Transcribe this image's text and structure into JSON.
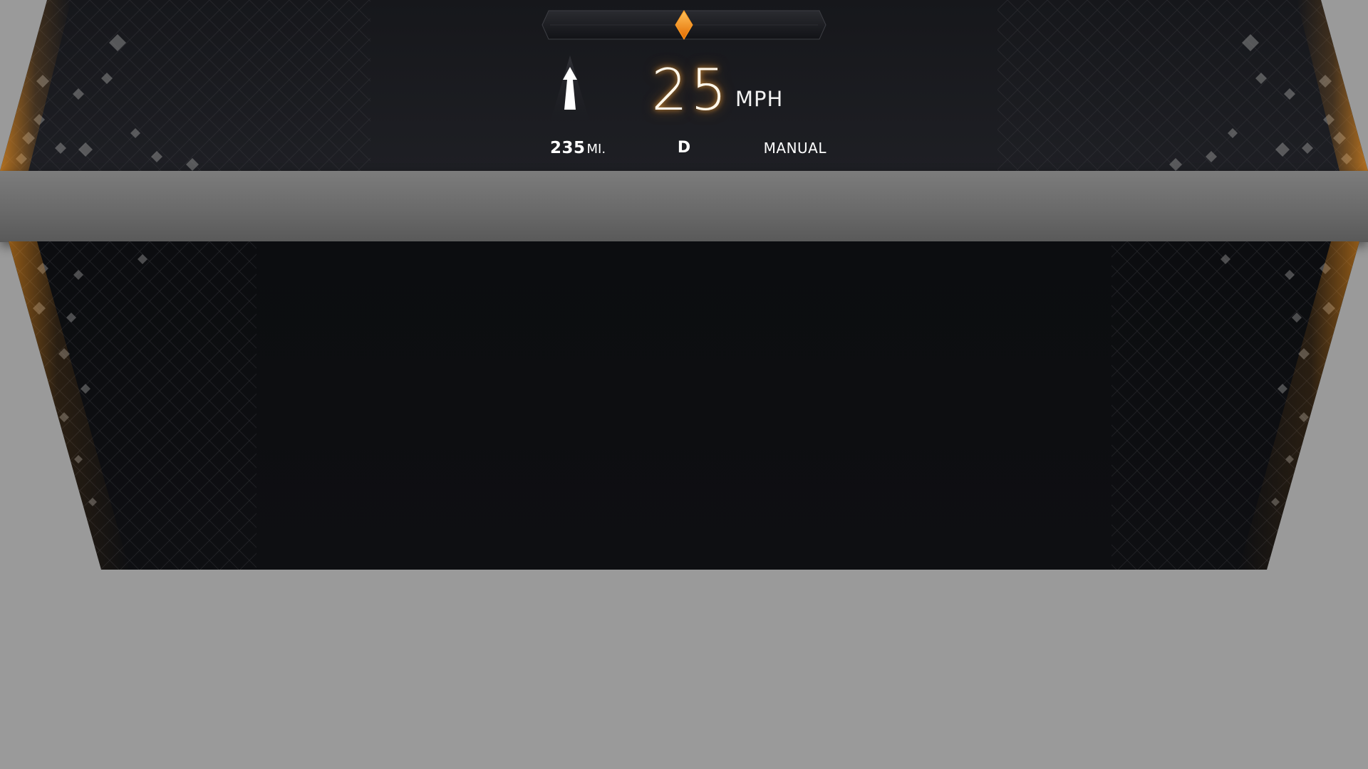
{
  "colors": {
    "accent": "#ff9a1f",
    "panel_dark": "#0d0e11",
    "panel_mid": "#1a1b1f",
    "backdrop": "#9a9a9a",
    "strip": "#6a6a6a"
  },
  "heading_indicator": {
    "icon": "diamond-marker-icon",
    "position_fraction": 0.5
  },
  "navigation": {
    "icon": "straight-ahead-arrow-icon"
  },
  "speed": {
    "value": "25",
    "unit": "MPH"
  },
  "status_bar": {
    "range_value": "235",
    "range_unit": "MI.",
    "gear": "D",
    "drive_mode": "MANUAL"
  }
}
